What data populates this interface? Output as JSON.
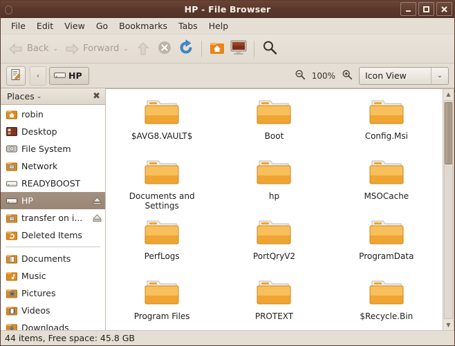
{
  "window": {
    "title": "HP - File Browser",
    "buttons": {
      "minimize": "–",
      "maximize": "□",
      "close": "✕"
    }
  },
  "menubar": {
    "items": [
      "File",
      "Edit",
      "View",
      "Go",
      "Bookmarks",
      "Tabs",
      "Help"
    ]
  },
  "toolbar": {
    "back_label": "Back",
    "forward_label": "Forward",
    "caret": "⌄",
    "icons": [
      "back-arrow-icon",
      "forward-arrow-icon",
      "up-arrow-icon",
      "stop-icon",
      "reload-icon",
      "home-icon",
      "computer-icon",
      "search-icon"
    ]
  },
  "location": {
    "edit_icon": "edit-location-icon",
    "back_chevron": "‹",
    "breadcrumb": "HP",
    "zoom_out_icon": "zoom-out-icon",
    "zoom_level": "100%",
    "zoom_in_icon": "zoom-in-icon",
    "view_mode": "Icon View",
    "view_mode_arrow": "⌄"
  },
  "sidebar": {
    "header": "Places",
    "header_chevron": "⌄",
    "close_icon": "✖",
    "items": [
      {
        "label": "robin",
        "icon": "home-folder-icon",
        "selected": false,
        "eject": false
      },
      {
        "label": "Desktop",
        "icon": "desktop-icon",
        "selected": false,
        "eject": false
      },
      {
        "label": "File System",
        "icon": "harddisk-icon",
        "selected": false,
        "eject": false
      },
      {
        "label": "Network",
        "icon": "network-icon",
        "selected": false,
        "eject": false
      },
      {
        "label": "READYBOOST",
        "icon": "drive-icon",
        "selected": false,
        "eject": false
      },
      {
        "label": "HP",
        "icon": "drive-icon",
        "selected": true,
        "eject": true
      },
      {
        "label": "transfer on i...",
        "icon": "network-drive-icon",
        "selected": false,
        "eject": true
      },
      {
        "label": "Deleted Items",
        "icon": "trash-folder-icon",
        "selected": false,
        "eject": false
      }
    ],
    "items2": [
      {
        "label": "Documents",
        "icon": "documents-icon"
      },
      {
        "label": "Music",
        "icon": "music-icon"
      },
      {
        "label": "Pictures",
        "icon": "pictures-icon"
      },
      {
        "label": "Videos",
        "icon": "videos-icon"
      },
      {
        "label": "Downloads",
        "icon": "downloads-icon"
      }
    ]
  },
  "files": [
    {
      "name": "$AVG8.VAULT$",
      "icon": "folder-icon"
    },
    {
      "name": "Boot",
      "icon": "folder-icon"
    },
    {
      "name": "Config.Msi",
      "icon": "folder-icon"
    },
    {
      "name": "Documents and Settings",
      "icon": "folder-icon"
    },
    {
      "name": "hp",
      "icon": "folder-icon"
    },
    {
      "name": "MSOCache",
      "icon": "folder-icon"
    },
    {
      "name": "PerfLogs",
      "icon": "folder-icon"
    },
    {
      "name": "PortQryV2",
      "icon": "folder-icon"
    },
    {
      "name": "ProgramData",
      "icon": "folder-icon"
    },
    {
      "name": "Program Files",
      "icon": "folder-icon"
    },
    {
      "name": "PROTEXT",
      "icon": "folder-icon"
    },
    {
      "name": "$Recycle.Bin",
      "icon": "folder-icon"
    }
  ],
  "scrollbar": {
    "up": "▲",
    "down": "▼"
  },
  "statusbar": {
    "text": "44 items, Free space: 45.8 GB"
  },
  "colors": {
    "titlebar": "#5b382c",
    "chrome": "#e4ded4",
    "selection": "#9a8676",
    "folder": "#f0a030",
    "accent_blue": "#3d8fd4"
  }
}
